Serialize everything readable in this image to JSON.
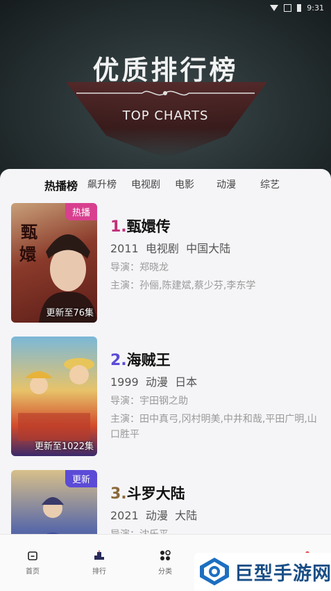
{
  "status_bar": {
    "time": "9:31"
  },
  "hero": {
    "title": "优质排行榜",
    "subtitle": "TOP CHARTS"
  },
  "tabs": [
    {
      "label": "热播榜",
      "active": true
    },
    {
      "label": "飙升榜",
      "active": false
    },
    {
      "label": "电视剧",
      "active": false
    },
    {
      "label": "电影",
      "active": false
    },
    {
      "label": "动漫",
      "active": false
    },
    {
      "label": "综艺",
      "active": false
    }
  ],
  "items": [
    {
      "rank": "1.",
      "rank_color": "#c2307a",
      "title": "甄嬛传",
      "year": "2011",
      "genre": "电视剧",
      "region": "中国大陆",
      "director": "导演：郑晓龙",
      "cast": "主演：孙俪,陈建斌,蔡少芬,李东学",
      "badge": "热播",
      "badge_color": "#d8408f",
      "episodes": "更新至76集"
    },
    {
      "rank": "2.",
      "rank_color": "#5b4bd6",
      "title": "海贼王",
      "year": "1999",
      "genre": "动漫",
      "region": "日本",
      "director": "导演：宇田钢之助",
      "cast": "主演：田中真弓,冈村明美,中井和哉,平田广明,山口胜平",
      "badge": "",
      "badge_color": "",
      "episodes": "更新至1022集"
    },
    {
      "rank": "3.",
      "rank_color": "#8b6a3a",
      "title": "斗罗大陆",
      "year": "2021",
      "genre": "动漫",
      "region": "大陆",
      "director": "导演：沈乐平",
      "cast": "",
      "badge": "更新",
      "badge_color": "#5b4bd6",
      "episodes": ""
    }
  ],
  "bottom_nav": [
    {
      "label": "首页",
      "icon": "home-icon"
    },
    {
      "label": "排行",
      "icon": "ranking-icon"
    },
    {
      "label": "分类",
      "icon": "category-icon"
    }
  ],
  "watermark": {
    "text": "巨型手游网"
  }
}
